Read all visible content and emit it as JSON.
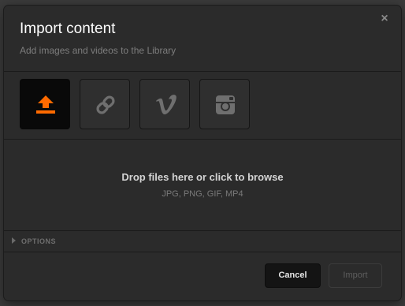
{
  "dialog": {
    "title": "Import content",
    "subtitle": "Add images and videos to the Library",
    "close_glyph": "×"
  },
  "sources": [
    {
      "name": "upload",
      "icon": "upload-icon",
      "active": true
    },
    {
      "name": "link",
      "icon": "link-icon",
      "active": false
    },
    {
      "name": "vimeo",
      "icon": "vimeo-icon",
      "active": false
    },
    {
      "name": "instagram",
      "icon": "instagram-icon",
      "active": false
    }
  ],
  "dropzone": {
    "main_text": "Drop files here or click to browse",
    "formats_text": "JPG, PNG, GIF, MP4"
  },
  "options": {
    "label": "OPTIONS",
    "expanded": false
  },
  "footer": {
    "cancel_label": "Cancel",
    "import_label": "Import",
    "import_enabled": false
  },
  "colors": {
    "accent": "#ff6a00",
    "modal_bg": "#2b2b2b",
    "icon_gray": "#6f6f6f"
  }
}
